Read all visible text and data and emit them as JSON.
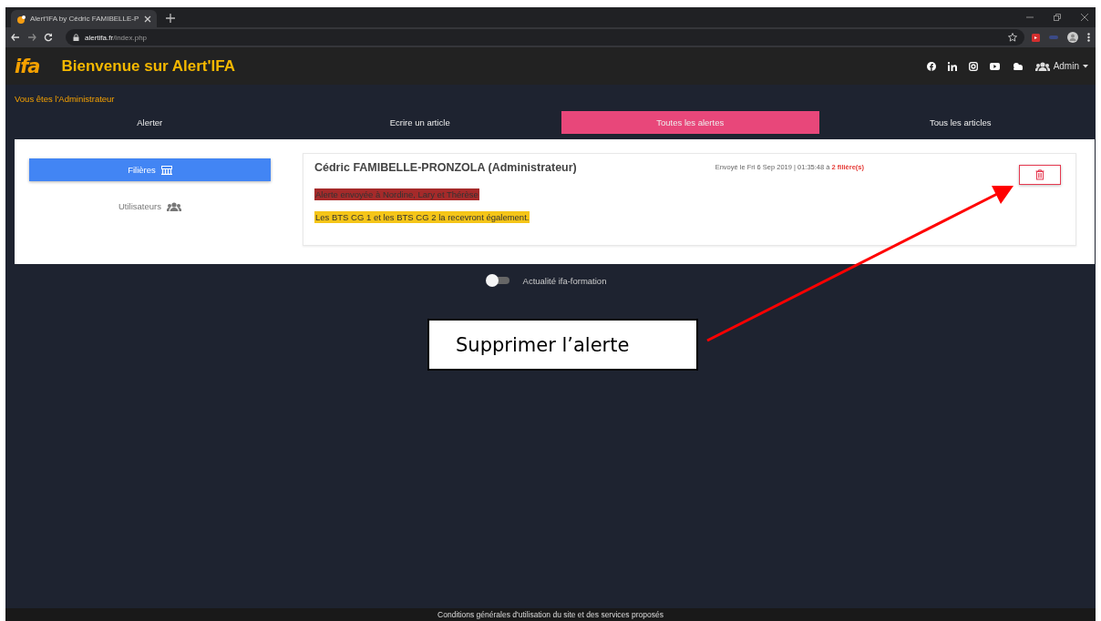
{
  "browser": {
    "tab_title": "Alert'IFA by Cédric FAMIBELLE-P",
    "url_domain": "alertifa.fr",
    "url_path": "/index.php"
  },
  "header": {
    "logo": "ifa",
    "title": "Bienvenue sur Alert'IFA",
    "user": "Admin"
  },
  "role_notice": "Vous êtes l'Administrateur",
  "tabs": [
    {
      "label": "Alerter",
      "selected": false
    },
    {
      "label": "Ecrire un article",
      "selected": false
    },
    {
      "label": "Toutes les alertes",
      "selected": true
    },
    {
      "label": "Tous les articles",
      "selected": false
    }
  ],
  "sidebar": {
    "items": [
      {
        "label": "Filières",
        "kind": "branches",
        "selected": true
      },
      {
        "label": "Utilisateurs",
        "kind": "users",
        "selected": false
      }
    ]
  },
  "alert": {
    "author": "Cédric FAMIBELLE-PRONZOLA (Administrateur)",
    "sent": "Envoyé le Fri 6 Sep 2019 | 01:35:48 à",
    "target": "2 filière(s)",
    "messages": [
      {
        "text": "Alerte envoyée à Nordine, Lary et Thérèse",
        "color": "#a52a2a"
      },
      {
        "text": "Les BTS CG 1 et les BTS CG 2 la recevront également.",
        "color": "#f5c518"
      }
    ]
  },
  "toggle": {
    "label": "Actualité ifa-formation",
    "on": false
  },
  "footer": "Conditions générales d'utilisation du site et des services proposés",
  "annotation": {
    "text": "Supprimer l’alerte"
  }
}
